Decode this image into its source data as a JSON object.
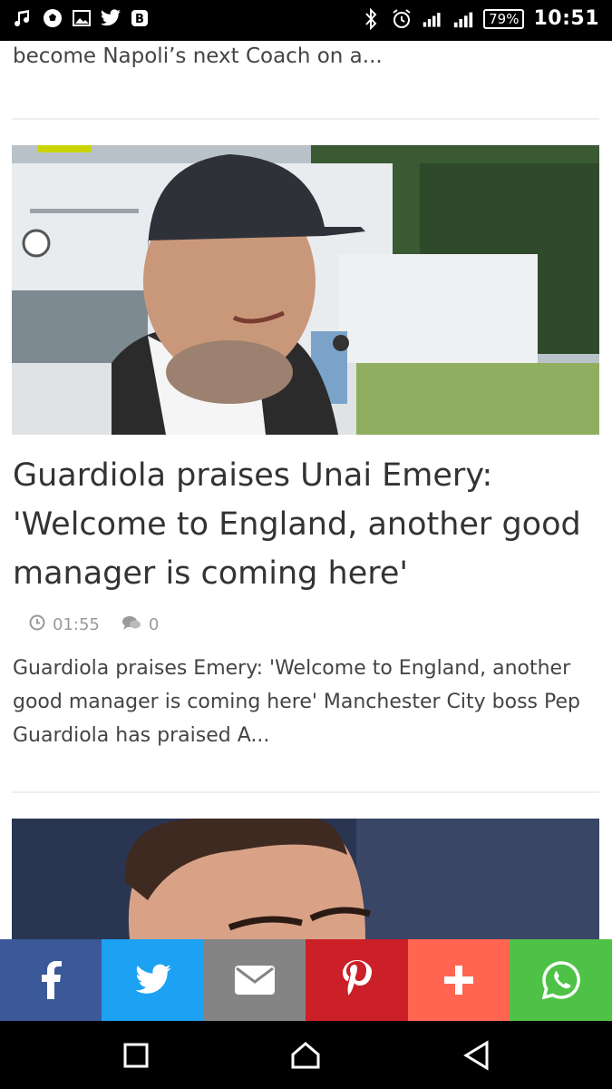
{
  "status_bar": {
    "battery": "79%",
    "time": "10:51",
    "left_icons": [
      "music-note-icon",
      "soccer-ball-icon",
      "image-icon",
      "twitter-icon",
      "blogger-icon"
    ],
    "right_icons": [
      "bluetooth-icon",
      "alarm-icon",
      "signal-icon",
      "signal-icon-2"
    ]
  },
  "previous_article": {
    "excerpt_tail": "become Napoli’s next Coach on a..."
  },
  "article": {
    "title": "Guardiola praises Unai Emery: 'Welcome to England, another good manager is coming here'",
    "time": "01:55",
    "comments": "0",
    "excerpt": "Guardiola praises Emery: 'Welcome to England, another good manager is coming here' Manchester City boss Pep Guardiola has praised A..."
  },
  "share_bar": [
    {
      "name": "facebook",
      "icon": "facebook-icon",
      "color": "#3b5998"
    },
    {
      "name": "twitter",
      "icon": "twitter-icon",
      "color": "#1da1f2"
    },
    {
      "name": "email",
      "icon": "email-icon",
      "color": "#848484"
    },
    {
      "name": "pinterest",
      "icon": "pinterest-icon",
      "color": "#cb2027"
    },
    {
      "name": "more",
      "icon": "plus-icon",
      "color": "#ff6550"
    },
    {
      "name": "whatsapp",
      "icon": "whatsapp-icon",
      "color": "#4dc247"
    }
  ],
  "nav_bar": [
    "recents-icon",
    "home-icon",
    "back-icon"
  ]
}
